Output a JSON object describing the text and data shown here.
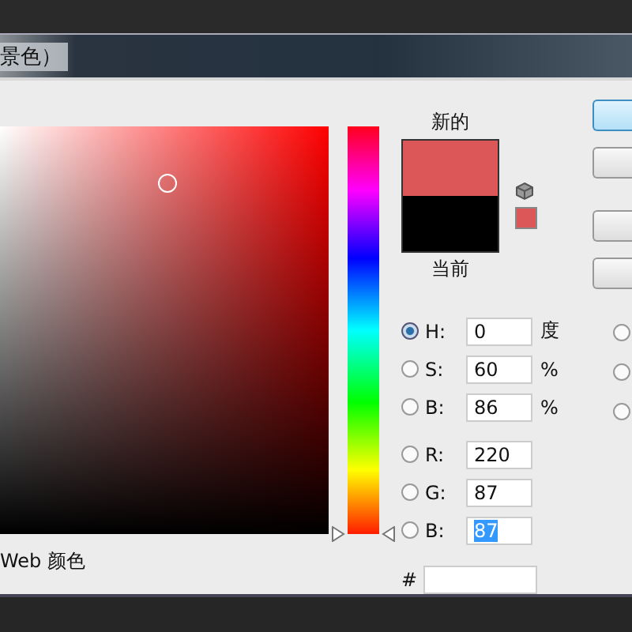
{
  "title": "景色）",
  "hue_slider": {
    "level": 0
  },
  "new_label": "新的",
  "current_label": "当前",
  "swatches": [
    {
      "color": "#dc5757"
    },
    {
      "color": "#000000"
    }
  ],
  "fields": [
    {
      "label": "H:",
      "value": "0",
      "unit": "度",
      "selected": true,
      "text_selected": false
    },
    {
      "label": "S:",
      "value": "60",
      "unit": "%",
      "selected": false,
      "text_selected": false
    },
    {
      "label": "B:",
      "value": "86",
      "unit": "%",
      "selected": false,
      "text_selected": false
    },
    {
      "label": "R:",
      "value": "220",
      "selected": false,
      "text_selected": false
    },
    {
      "label": "G:",
      "value": "87",
      "selected": false,
      "text_selected": false
    },
    {
      "label": "B:",
      "value": "87",
      "selected": false,
      "text_selected": true
    }
  ],
  "right_radios": [
    {
      "selected": false
    },
    {
      "selected": false
    },
    {
      "selected": false
    }
  ],
  "web_colors": {
    "label": "Web 颜色"
  },
  "hex": {
    "label": "#"
  },
  "buttons": [
    {
      "kind": "default"
    },
    {
      "kind": "normal"
    },
    {
      "kind": "normal"
    },
    {
      "kind": "normal"
    }
  ]
}
